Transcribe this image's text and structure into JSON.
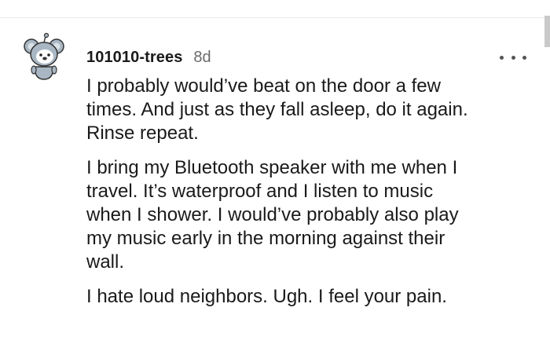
{
  "comment": {
    "username": "101010-trees",
    "age": "8d",
    "avatar": "snoo-koala-avatar",
    "more_icon": "more-horizontal-icon",
    "paragraphs": [
      {
        "lines": [
          "I probably would’ve beat on the door a few",
          "times. And just as they fall asleep, do it again.",
          "Rinse repeat."
        ]
      },
      {
        "lines": [
          "I bring my Bluetooth speaker with me when I",
          "travel. It’s waterproof and I listen to music",
          "when I shower. I would’ve probably also play",
          "my music early in the morning against their",
          "wall."
        ]
      },
      {
        "lines": [
          "I hate loud neighbors. Ugh. I feel your pain."
        ]
      }
    ]
  },
  "colors": {
    "text": "#1a1a1b",
    "meta": "#6b6b6b",
    "divider": "#e8e8e8",
    "avatar_fur": "#a9b7c4"
  }
}
